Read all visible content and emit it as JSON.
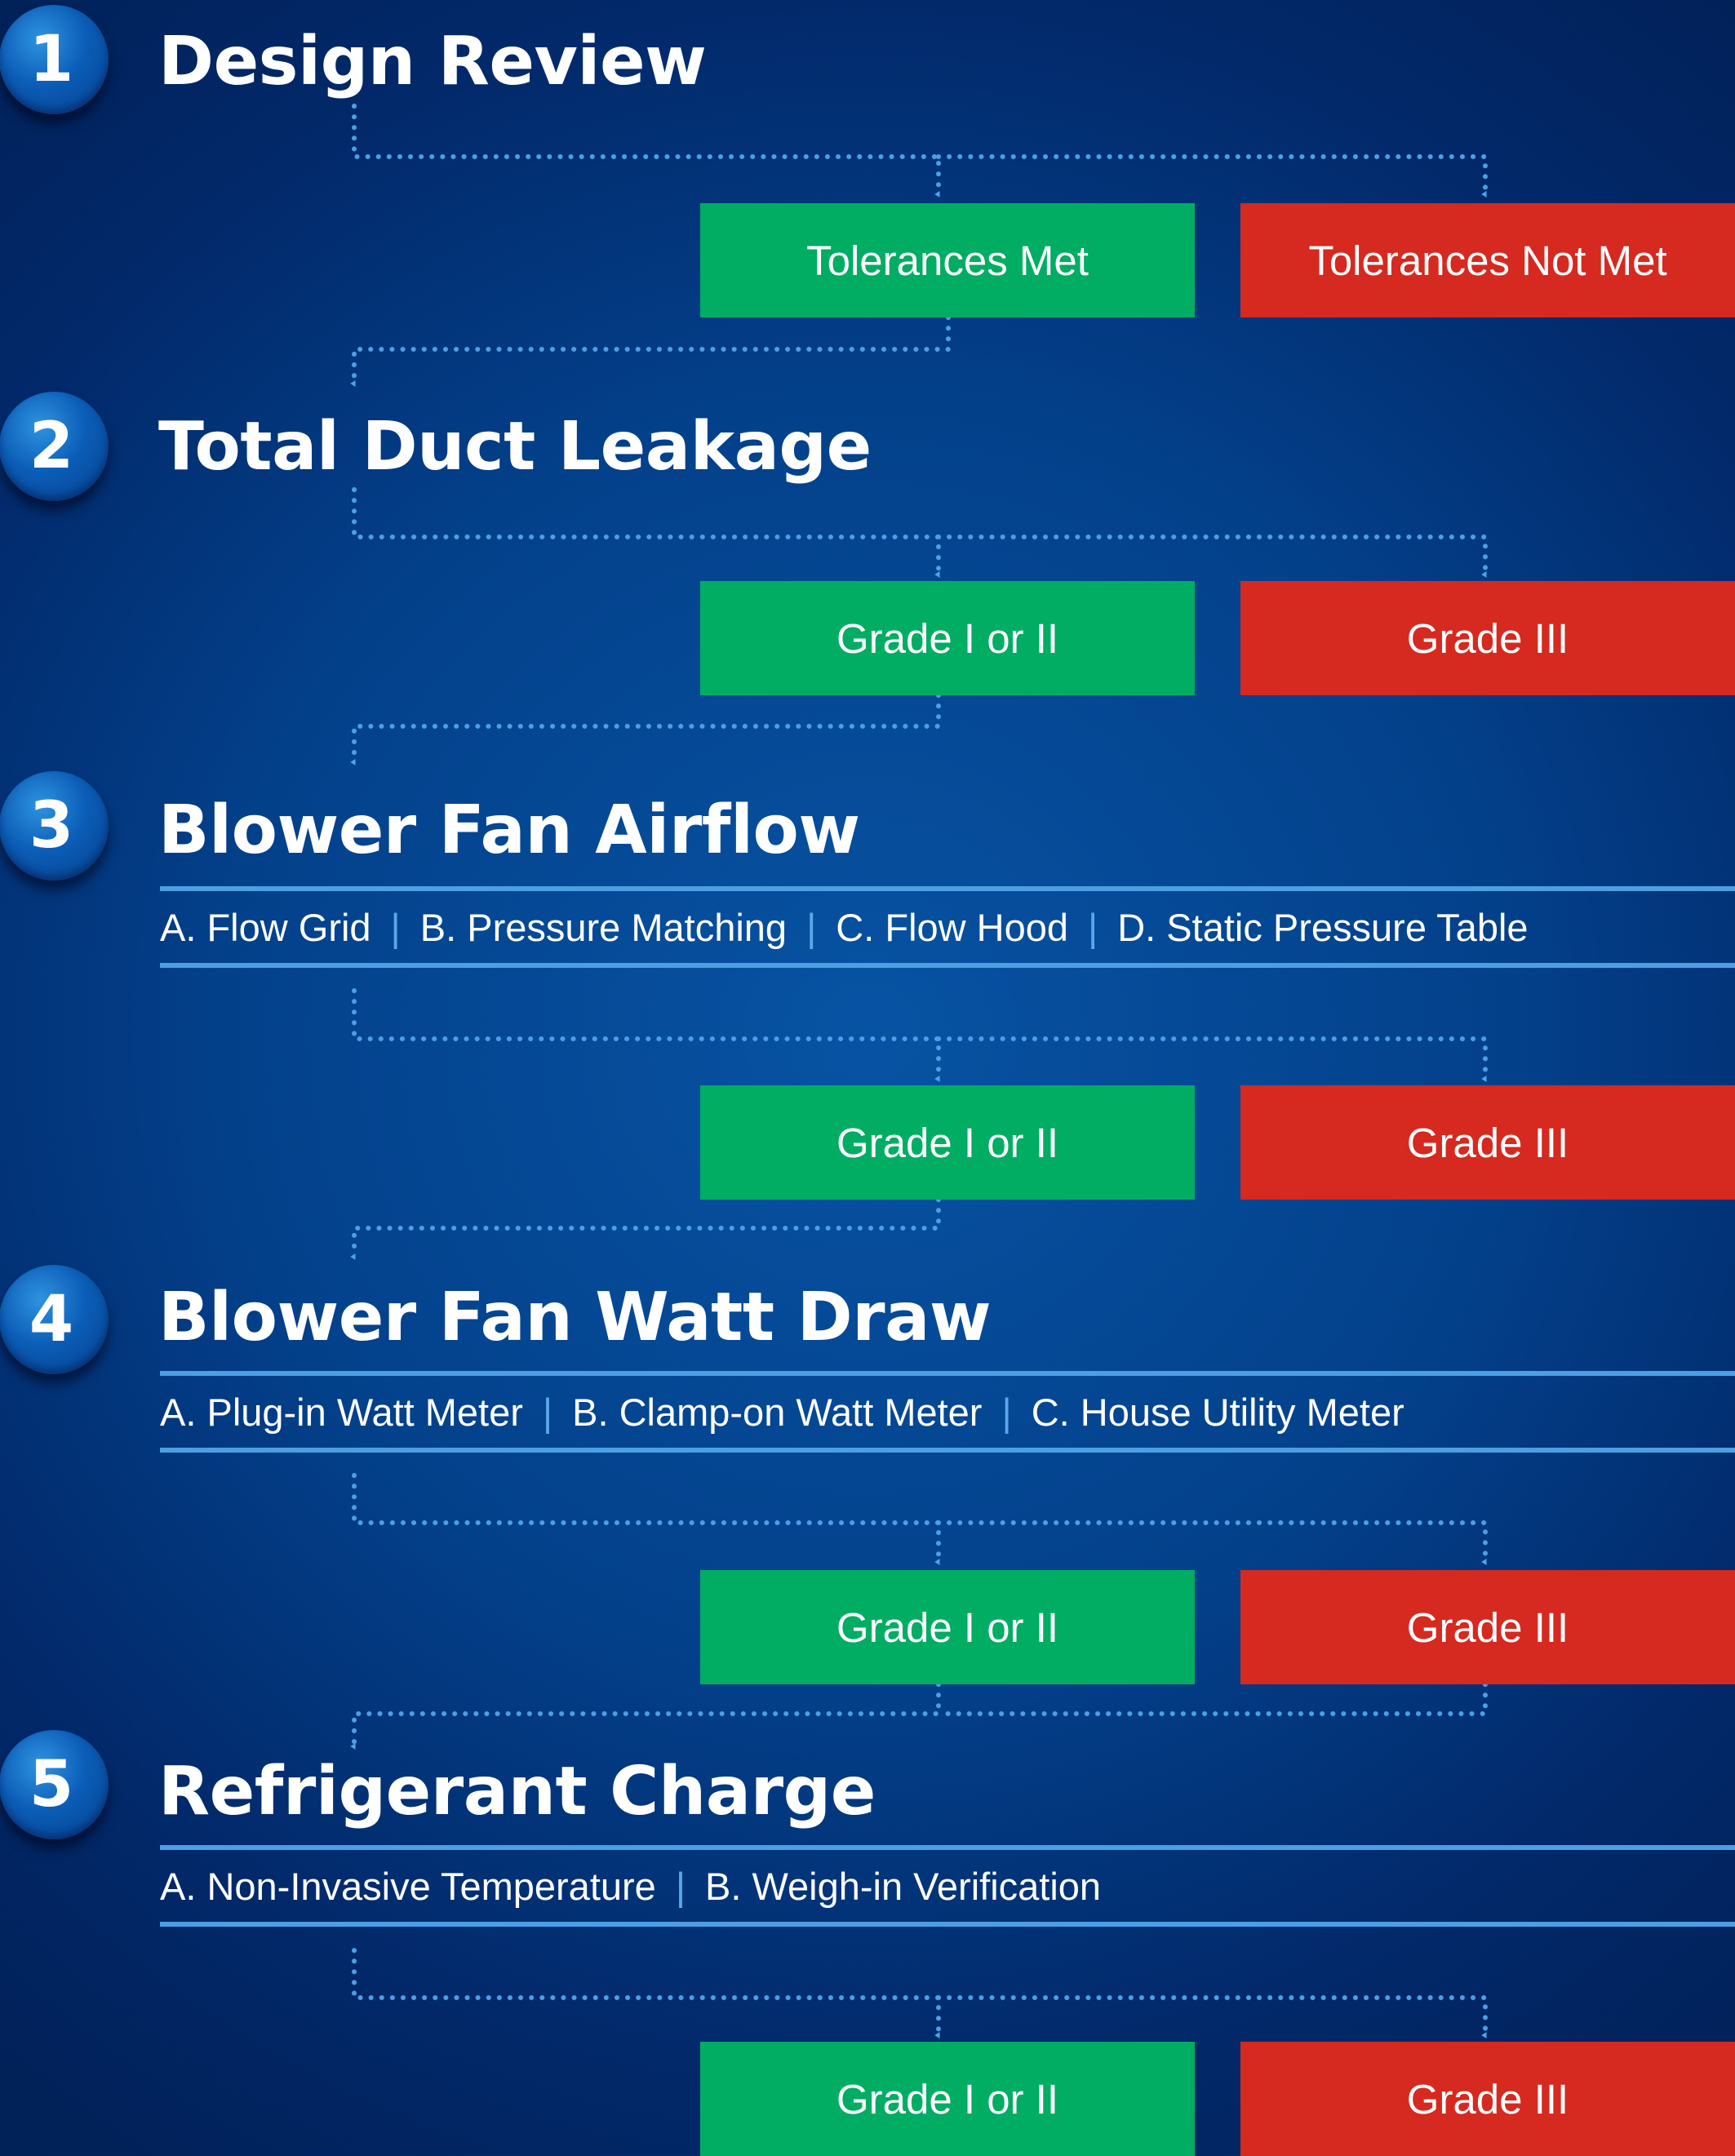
{
  "steps": [
    {
      "number": "1",
      "title": "Design Review",
      "methods": [],
      "outcomes": {
        "pass": "Tolerances Met",
        "fail": "Tolerances Not Met"
      }
    },
    {
      "number": "2",
      "title": "Total Duct Leakage",
      "methods": [],
      "outcomes": {
        "pass": "Grade I or II",
        "fail": "Grade III"
      }
    },
    {
      "number": "3",
      "title": "Blower Fan Airflow",
      "methods": [
        "A. Flow Grid",
        "B. Pressure Matching",
        "C. Flow Hood",
        "D. Static Pressure Table"
      ],
      "outcomes": {
        "pass": "Grade I or II",
        "fail": "Grade III"
      }
    },
    {
      "number": "4",
      "title": "Blower Fan Watt Draw",
      "methods": [
        "A. Plug-in Watt Meter",
        "B. Clamp-on Watt Meter",
        "C. House Utility Meter"
      ],
      "outcomes": {
        "pass": "Grade I or II",
        "fail": "Grade III"
      }
    },
    {
      "number": "5",
      "title": "Refrigerant Charge",
      "methods": [
        "A. Non-Invasive Temperature",
        "B. Weigh-in Verification"
      ],
      "outcomes": {
        "pass": "Grade I or II",
        "fail": "Grade III"
      }
    }
  ],
  "colors": {
    "pass": "#00ad63",
    "fail": "#d6291f",
    "connector": "#4c9fe3",
    "circle": "#0b5db7"
  }
}
